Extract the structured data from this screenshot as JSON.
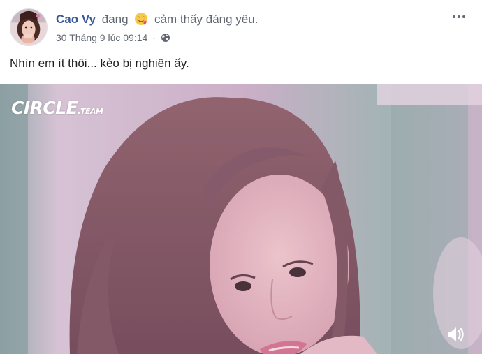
{
  "post": {
    "author_name": "Cao Vy",
    "feeling_prefix": "đang",
    "feeling_emoji": "lovestruck-face-emoji",
    "feeling_text": "cảm thấy đáng yêu.",
    "timestamp": "30 Tháng 9 lúc 09:14",
    "separator": "·",
    "privacy_icon": "globe-icon",
    "more_icon": "more-options-icon",
    "caption": "Nhìn em ít thôi... kẻo bị nghiện ấy."
  },
  "video": {
    "watermark_main": "CIRCLE",
    "watermark_sub": ".TEAM",
    "sound_icon": "speaker-icon"
  },
  "colors": {
    "author_link": "#385898",
    "secondary_text": "#606770",
    "meta_text": "#90949c",
    "video_tint": "#c8a3c8"
  }
}
